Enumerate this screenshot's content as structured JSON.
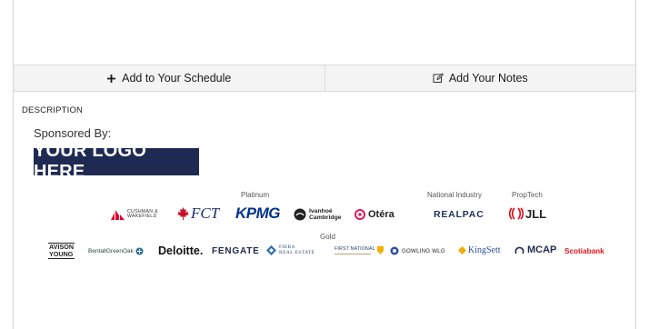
{
  "actions": {
    "add_schedule": "Add to Your Schedule",
    "add_notes": "Add Your Notes"
  },
  "description_label": "DESCRIPTION",
  "sponsored_by": "Sponsored By:",
  "logo_placeholder": "YOUR LOGO HERE",
  "tiers": {
    "platinum": "Platinum",
    "national": "National Industry",
    "proptech": "PropTech",
    "gold": "Gold"
  },
  "sponsors": {
    "cushman_l1": "CUSHMAN &",
    "cushman_l2": "WAKEFIELD",
    "fct": "FCT",
    "kpmg": "KPMG",
    "ivanhoe_l1": "Ivanhoé",
    "ivanhoe_l2": "Cambridge",
    "otera": "Otéra",
    "realpac": "REALPAC",
    "jll": "JLL",
    "avison_l1": "AVISON",
    "avison_l2": "YOUNG",
    "bentall": "BentallGreenOak",
    "deloitte": "Deloitte.",
    "fengate": "FENGATE",
    "fiera_l1": "FIERA",
    "fiera_l2": "REAL ESTATE",
    "firstnational": "FIRST NATIONAL",
    "gowling": "GOWLING WLG",
    "kingsett": "KingSett",
    "mcap": "MCAP",
    "scotiabank": "Scotiabank"
  },
  "colors": {
    "logo_bg": "#1e2a52",
    "cushman_red": "#e4032e",
    "fct_red": "#c8102e",
    "kpmg_blue": "#00338d",
    "realpac_navy": "#1c2f5e",
    "jll_red": "#e30613",
    "scotia_red": "#ec111a",
    "kingsett_blue": "#2a4ea0",
    "fengate_navy": "#1e2a4a"
  }
}
